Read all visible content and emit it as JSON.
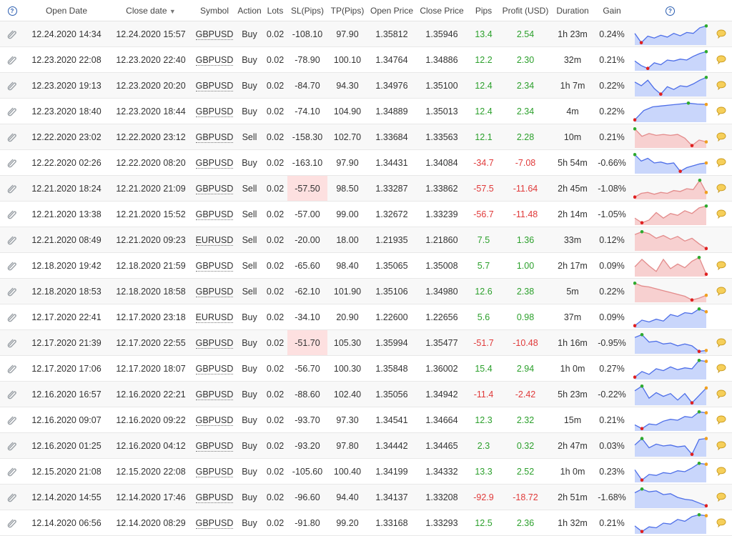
{
  "header": {
    "open_date": "Open Date",
    "close_date": "Close date",
    "symbol": "Symbol",
    "action": "Action",
    "lots": "Lots",
    "sl": "SL(Pips)",
    "tp": "TP(Pips)",
    "open_price": "Open Price",
    "close_price": "Close Price",
    "pips": "Pips",
    "profit": "Profit (USD)",
    "duration": "Duration",
    "gain": "Gain",
    "help_icon": "question-circle-icon",
    "sort_icon": "triangle-down-icon"
  },
  "colors": {
    "positive": "#2ca02c",
    "negative": "#e03a3a",
    "sl_highlight": "#fde0e0",
    "chart_buy_fill": "#c9d6fb",
    "chart_buy_line": "#4d6ee8",
    "chart_sell_fill": "#f7d0d0",
    "chart_sell_line": "#e38b8b",
    "marker_high": "#2eaa2e",
    "marker_low": "#e02020",
    "marker_end": "#f0a020"
  },
  "trades": [
    {
      "open": "12.24.2020 14:34",
      "close": "12.24.2020 15:57",
      "symbol": "GBPUSD",
      "action": "Buy",
      "lots": "0.02",
      "sl": "-108.10",
      "tp": "97.90",
      "open_price": "1.35812",
      "close_price": "1.35946",
      "pips": "13.4",
      "profit": "2.54",
      "duration": "1h 23m",
      "gain": "0.24%",
      "spark": [
        0.55,
        0.05,
        0.4,
        0.3,
        0.45,
        0.35,
        0.55,
        0.42,
        0.6,
        0.55,
        0.85,
        0.95
      ],
      "comment": true
    },
    {
      "open": "12.23.2020 22:08",
      "close": "12.23.2020 22:40",
      "symbol": "GBPUSD",
      "action": "Buy",
      "lots": "0.02",
      "sl": "-78.90",
      "tp": "100.10",
      "open_price": "1.34764",
      "close_price": "1.34886",
      "pips": "12.2",
      "profit": "2.30",
      "duration": "32m",
      "gain": "0.21%",
      "spark": [
        0.45,
        0.2,
        0.05,
        0.35,
        0.25,
        0.5,
        0.45,
        0.55,
        0.5,
        0.7,
        0.85,
        0.95
      ],
      "comment": true
    },
    {
      "open": "12.23.2020 19:13",
      "close": "12.23.2020 20:20",
      "symbol": "GBPUSD",
      "action": "Buy",
      "lots": "0.02",
      "sl": "-84.70",
      "tp": "94.30",
      "open_price": "1.34976",
      "close_price": "1.35100",
      "pips": "12.4",
      "profit": "2.34",
      "duration": "1h 7m",
      "gain": "0.22%",
      "spark": [
        0.7,
        0.5,
        0.8,
        0.35,
        0.05,
        0.45,
        0.3,
        0.5,
        0.45,
        0.6,
        0.8,
        0.95
      ],
      "comment": true
    },
    {
      "open": "12.23.2020 18:40",
      "close": "12.23.2020 18:44",
      "symbol": "GBPUSD",
      "action": "Buy",
      "lots": "0.02",
      "sl": "-74.10",
      "tp": "104.90",
      "open_price": "1.34889",
      "close_price": "1.35013",
      "pips": "12.4",
      "profit": "2.34",
      "duration": "4m",
      "gain": "0.22%",
      "spark": [
        0.05,
        0.55,
        0.75,
        0.8,
        0.85,
        0.9,
        0.95,
        0.9,
        0.88
      ],
      "comment": true
    },
    {
      "open": "12.22.2020 23:02",
      "close": "12.22.2020 23:12",
      "symbol": "GBPUSD",
      "action": "Sell",
      "lots": "0.02",
      "sl": "-158.30",
      "tp": "102.70",
      "open_price": "1.33684",
      "close_price": "1.33563",
      "pips": "12.1",
      "profit": "2.28",
      "duration": "10m",
      "gain": "0.21%",
      "spark": [
        0.95,
        0.55,
        0.7,
        0.6,
        0.65,
        0.6,
        0.65,
        0.45,
        0.05,
        0.35,
        0.25
      ],
      "comment": true
    },
    {
      "open": "12.22.2020 02:26",
      "close": "12.22.2020 08:20",
      "symbol": "GBPUSD",
      "action": "Buy",
      "lots": "0.02",
      "sl": "-163.10",
      "tp": "97.90",
      "open_price": "1.34431",
      "close_price": "1.34084",
      "pips": "-34.7",
      "profit": "-7.08",
      "duration": "5h 54m",
      "gain": "-0.66%",
      "spark": [
        0.95,
        0.6,
        0.75,
        0.5,
        0.55,
        0.45,
        0.5,
        0.05,
        0.25,
        0.35,
        0.45,
        0.5
      ],
      "comment": true
    },
    {
      "open": "12.21.2020 18:24",
      "close": "12.21.2020 21:09",
      "symbol": "GBPUSD",
      "action": "Sell",
      "lots": "0.02",
      "sl": "-57.50",
      "sl_hi": true,
      "tp": "98.50",
      "open_price": "1.33287",
      "close_price": "1.33862",
      "pips": "-57.5",
      "profit": "-11.64",
      "duration": "2h 45m",
      "gain": "-1.08%",
      "spark": [
        0.05,
        0.25,
        0.3,
        0.2,
        0.3,
        0.25,
        0.4,
        0.35,
        0.5,
        0.45,
        0.95,
        0.3
      ],
      "comment": true
    },
    {
      "open": "12.21.2020 13:38",
      "close": "12.21.2020 15:52",
      "symbol": "GBPUSD",
      "action": "Sell",
      "lots": "0.02",
      "sl": "-57.00",
      "tp": "99.00",
      "open_price": "1.32672",
      "close_price": "1.33239",
      "pips": "-56.7",
      "profit": "-11.48",
      "duration": "2h 14m",
      "gain": "-1.05%",
      "spark": [
        0.3,
        0.05,
        0.2,
        0.6,
        0.3,
        0.55,
        0.45,
        0.7,
        0.55,
        0.85,
        0.95
      ],
      "comment": true
    },
    {
      "open": "12.21.2020 08:49",
      "close": "12.21.2020 09:23",
      "symbol": "EURUSD",
      "action": "Sell",
      "lots": "0.02",
      "sl": "-20.00",
      "tp": "18.00",
      "open_price": "1.21935",
      "close_price": "1.21860",
      "pips": "7.5",
      "profit": "1.36",
      "duration": "33m",
      "gain": "0.12%",
      "spark": [
        0.8,
        0.95,
        0.85,
        0.6,
        0.75,
        0.55,
        0.7,
        0.45,
        0.6,
        0.3,
        0.05
      ],
      "comment": false
    },
    {
      "open": "12.18.2020 19:42",
      "close": "12.18.2020 21:59",
      "symbol": "GBPUSD",
      "action": "Sell",
      "lots": "0.02",
      "sl": "-65.60",
      "tp": "98.40",
      "open_price": "1.35065",
      "close_price": "1.35008",
      "pips": "5.7",
      "profit": "1.00",
      "duration": "2h 17m",
      "gain": "0.09%",
      "spark": [
        0.45,
        0.85,
        0.5,
        0.2,
        0.85,
        0.35,
        0.6,
        0.4,
        0.75,
        0.95,
        0.05
      ],
      "comment": true
    },
    {
      "open": "12.18.2020 18:53",
      "close": "12.18.2020 18:58",
      "symbol": "GBPUSD",
      "action": "Sell",
      "lots": "0.02",
      "sl": "-62.10",
      "tp": "101.90",
      "open_price": "1.35106",
      "close_price": "1.34980",
      "pips": "12.6",
      "profit": "2.38",
      "duration": "5m",
      "gain": "0.22%",
      "spark": [
        0.95,
        0.8,
        0.75,
        0.65,
        0.55,
        0.45,
        0.35,
        0.25,
        0.05,
        0.15,
        0.3
      ],
      "comment": true
    },
    {
      "open": "12.17.2020 22:41",
      "close": "12.17.2020 23:18",
      "symbol": "EURUSD",
      "action": "Buy",
      "lots": "0.02",
      "sl": "-34.10",
      "tp": "20.90",
      "open_price": "1.22600",
      "close_price": "1.22656",
      "pips": "5.6",
      "profit": "0.98",
      "duration": "37m",
      "gain": "0.09%",
      "spark": [
        0.05,
        0.35,
        0.25,
        0.4,
        0.3,
        0.65,
        0.55,
        0.75,
        0.7,
        0.95,
        0.8
      ],
      "comment": false
    },
    {
      "open": "12.17.2020 21:39",
      "close": "12.17.2020 22:55",
      "symbol": "GBPUSD",
      "action": "Buy",
      "lots": "0.02",
      "sl": "-51.70",
      "sl_hi": true,
      "tp": "105.30",
      "open_price": "1.35994",
      "close_price": "1.35477",
      "pips": "-51.7",
      "profit": "-10.48",
      "duration": "1h 16m",
      "gain": "-0.95%",
      "spark": [
        0.8,
        0.95,
        0.55,
        0.6,
        0.45,
        0.5,
        0.35,
        0.45,
        0.35,
        0.05,
        0.1
      ],
      "comment": true
    },
    {
      "open": "12.17.2020 17:06",
      "close": "12.17.2020 18:07",
      "symbol": "GBPUSD",
      "action": "Buy",
      "lots": "0.02",
      "sl": "-56.70",
      "tp": "100.30",
      "open_price": "1.35848",
      "close_price": "1.36002",
      "pips": "15.4",
      "profit": "2.94",
      "duration": "1h 0m",
      "gain": "0.27%",
      "spark": [
        0.05,
        0.35,
        0.2,
        0.5,
        0.4,
        0.6,
        0.45,
        0.55,
        0.5,
        0.95,
        0.9
      ],
      "comment": true
    },
    {
      "open": "12.16.2020 16:57",
      "close": "12.16.2020 22:21",
      "symbol": "GBPUSD",
      "action": "Buy",
      "lots": "0.02",
      "sl": "-88.60",
      "tp": "102.40",
      "open_price": "1.35056",
      "close_price": "1.34942",
      "pips": "-11.4",
      "profit": "-2.42",
      "duration": "5h 23m",
      "gain": "-0.22%",
      "spark": [
        0.7,
        0.95,
        0.3,
        0.6,
        0.4,
        0.55,
        0.2,
        0.55,
        0.05,
        0.45,
        0.85
      ],
      "comment": true
    },
    {
      "open": "12.16.2020 09:07",
      "close": "12.16.2020 09:22",
      "symbol": "GBPUSD",
      "action": "Buy",
      "lots": "0.02",
      "sl": "-93.70",
      "tp": "97.30",
      "open_price": "1.34541",
      "close_price": "1.34664",
      "pips": "12.3",
      "profit": "2.32",
      "duration": "15m",
      "gain": "0.21%",
      "spark": [
        0.25,
        0.05,
        0.3,
        0.25,
        0.45,
        0.55,
        0.5,
        0.7,
        0.65,
        0.95,
        0.9
      ],
      "comment": true
    },
    {
      "open": "12.16.2020 01:25",
      "close": "12.16.2020 04:12",
      "symbol": "GBPUSD",
      "action": "Buy",
      "lots": "0.02",
      "sl": "-93.20",
      "tp": "97.80",
      "open_price": "1.34442",
      "close_price": "1.34465",
      "pips": "2.3",
      "profit": "0.32",
      "duration": "2h 47m",
      "gain": "0.03%",
      "spark": [
        0.55,
        0.9,
        0.4,
        0.6,
        0.5,
        0.55,
        0.45,
        0.5,
        0.05,
        0.85,
        0.9
      ],
      "comment": true
    },
    {
      "open": "12.15.2020 21:08",
      "close": "12.15.2020 22:08",
      "symbol": "GBPUSD",
      "action": "Buy",
      "lots": "0.02",
      "sl": "-105.60",
      "tp": "100.40",
      "open_price": "1.34199",
      "close_price": "1.34332",
      "pips": "13.3",
      "profit": "2.52",
      "duration": "1h 0m",
      "gain": "0.23%",
      "spark": [
        0.6,
        0.05,
        0.35,
        0.3,
        0.45,
        0.4,
        0.55,
        0.5,
        0.7,
        0.95,
        0.9
      ],
      "comment": true
    },
    {
      "open": "12.14.2020 14:55",
      "close": "12.14.2020 17:46",
      "symbol": "GBPUSD",
      "action": "Buy",
      "lots": "0.02",
      "sl": "-96.60",
      "tp": "94.40",
      "open_price": "1.34137",
      "close_price": "1.33208",
      "pips": "-92.9",
      "profit": "-18.72",
      "duration": "2h 51m",
      "gain": "-1.68%",
      "spark": [
        0.75,
        0.95,
        0.8,
        0.85,
        0.65,
        0.7,
        0.5,
        0.4,
        0.35,
        0.2,
        0.05
      ],
      "comment": true
    },
    {
      "open": "12.14.2020 06:56",
      "close": "12.14.2020 08:29",
      "symbol": "GBPUSD",
      "action": "Buy",
      "lots": "0.02",
      "sl": "-91.80",
      "tp": "99.20",
      "open_price": "1.33168",
      "close_price": "1.33293",
      "pips": "12.5",
      "profit": "2.36",
      "duration": "1h 32m",
      "gain": "0.21%",
      "spark": [
        0.35,
        0.05,
        0.3,
        0.25,
        0.5,
        0.45,
        0.7,
        0.6,
        0.85,
        0.95,
        0.9
      ],
      "comment": true
    }
  ]
}
